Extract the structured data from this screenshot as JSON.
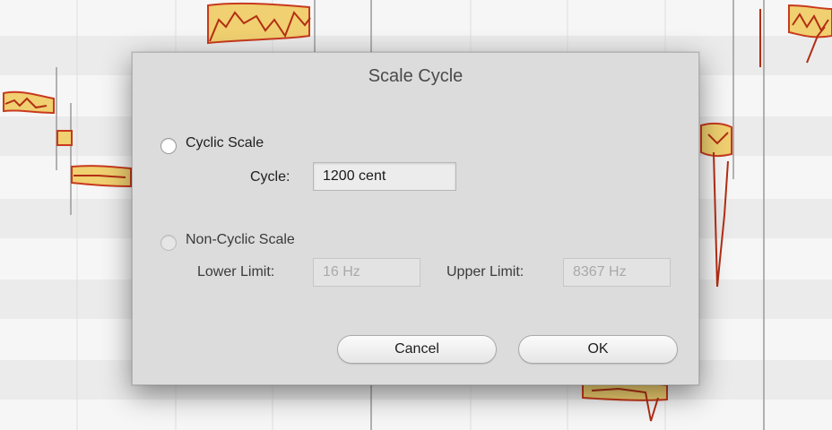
{
  "dialog": {
    "title": "Scale Cycle",
    "cyclic_option_label": "Cyclic Scale",
    "cyclic_option_selected": false,
    "cycle_label": "Cycle:",
    "cycle_value": "1200 cent",
    "noncyclic_option_label": "Non-Cyclic Scale",
    "noncyclic_option_selected": false,
    "lower_limit_label": "Lower Limit:",
    "lower_limit_value": "16 Hz",
    "upper_limit_label": "Upper Limit:",
    "upper_limit_value": "8367 Hz",
    "cancel_label": "Cancel",
    "ok_label": "OK"
  },
  "colors": {
    "dialog_bg": "#dcdcdc",
    "blob_fill": "#f0d070",
    "blob_outline": "#c83a1e",
    "grid_line": "#9a9a9a"
  }
}
